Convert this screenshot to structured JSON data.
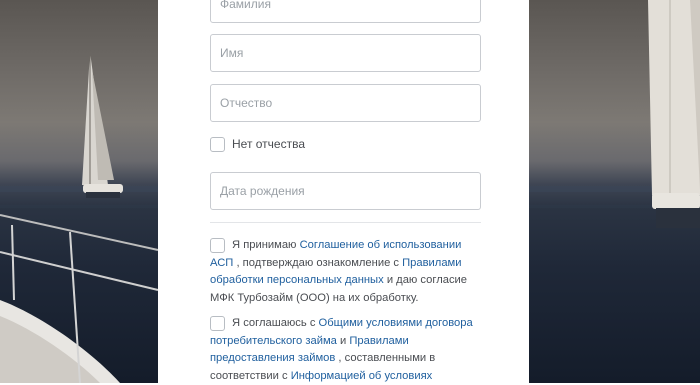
{
  "form": {
    "surname": {
      "placeholder": "Фамилия",
      "value": ""
    },
    "name": {
      "placeholder": "Имя",
      "value": ""
    },
    "patronymic": {
      "placeholder": "Отчество",
      "value": ""
    },
    "no_patronymic_label": "Нет отчества",
    "birth_date": {
      "placeholder": "Дата рождения",
      "value": ""
    }
  },
  "consents": [
    {
      "parts": [
        {
          "text": "Я принимаю ",
          "link": false
        },
        {
          "text": "Соглашение об использовании АСП",
          "link": true
        },
        {
          "text": ", подтверждаю ознакомление с ",
          "link": false
        },
        {
          "text": "Правилами обработки персональных данных",
          "link": true
        },
        {
          "text": " и даю согласие МФК Турбозайм (ООО) на их обработку.",
          "link": false
        }
      ]
    },
    {
      "parts": [
        {
          "text": "Я соглашаюсь с ",
          "link": false
        },
        {
          "text": "Общими условиями договора потребительского займа",
          "link": true
        },
        {
          "text": " и ",
          "link": false
        },
        {
          "text": "Правилами предоставления займов",
          "link": true
        },
        {
          "text": ", составленными в соответствии с ",
          "link": false
        },
        {
          "text": "Информацией об условиях",
          "link": true
        }
      ]
    }
  ],
  "colors": {
    "link": "#1f5f9e",
    "border": "#c9ccd1",
    "text": "#4a4d52",
    "placeholder": "#9aa0a6"
  }
}
